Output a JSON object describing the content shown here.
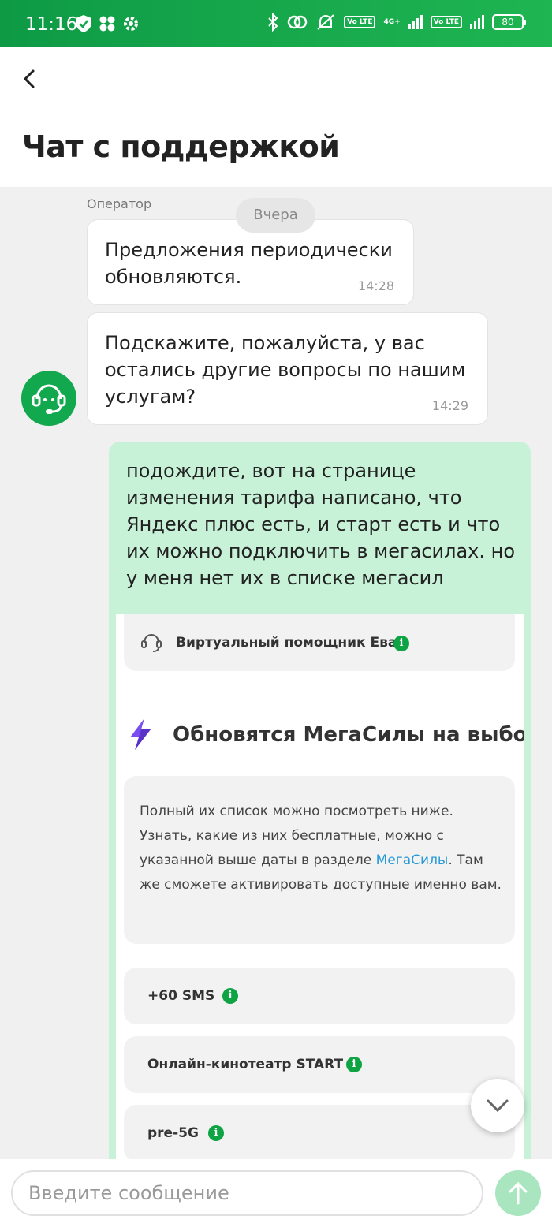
{
  "status_bar": {
    "time": "11:16",
    "network": "4G+",
    "battery": "80",
    "volte_1": "Vo LTE",
    "volte_2": "Vo LTE"
  },
  "header": {
    "back_icon": "chevron-left-icon",
    "title": "Чат с поддержкой"
  },
  "chat": {
    "sender": "Оператор",
    "date_separator": "Вчера",
    "messages": [
      {
        "text": "Предложения периодически обновляются.",
        "time": "14:28"
      },
      {
        "text": "Подскажите, пожалуйста, у вас остались другие вопросы по нашим услугам?",
        "time": "14:29"
      }
    ],
    "user_message": "подождите, вот на странице изменения тарифа написано, что Яндекс плюс есть, и старт есть и что их можно подключить в мегасилах. но у меня нет их в списке мегасил",
    "attachment": {
      "assistant_label": "Виртуальный помощник Ева",
      "title": "Обновятся МегаСилы на выбор",
      "paragraph_before_link": "Полный их список можно посмотреть ниже. Узнать, какие из них бесплатные, можно с указанной выше даты в разделе ",
      "link_text": "МегаСилы",
      "paragraph_after_link": ". Там же сможете активировать доступные именно вам.",
      "options": [
        "+60 SMS",
        "Онлайн-кинотеатр START",
        "pre-5G"
      ]
    }
  },
  "input": {
    "placeholder": "Введите сообщение"
  },
  "colors": {
    "brand_green": "#11a84e",
    "user_bubble": "#c8f2d8",
    "send_button": "#a9e6bf"
  }
}
